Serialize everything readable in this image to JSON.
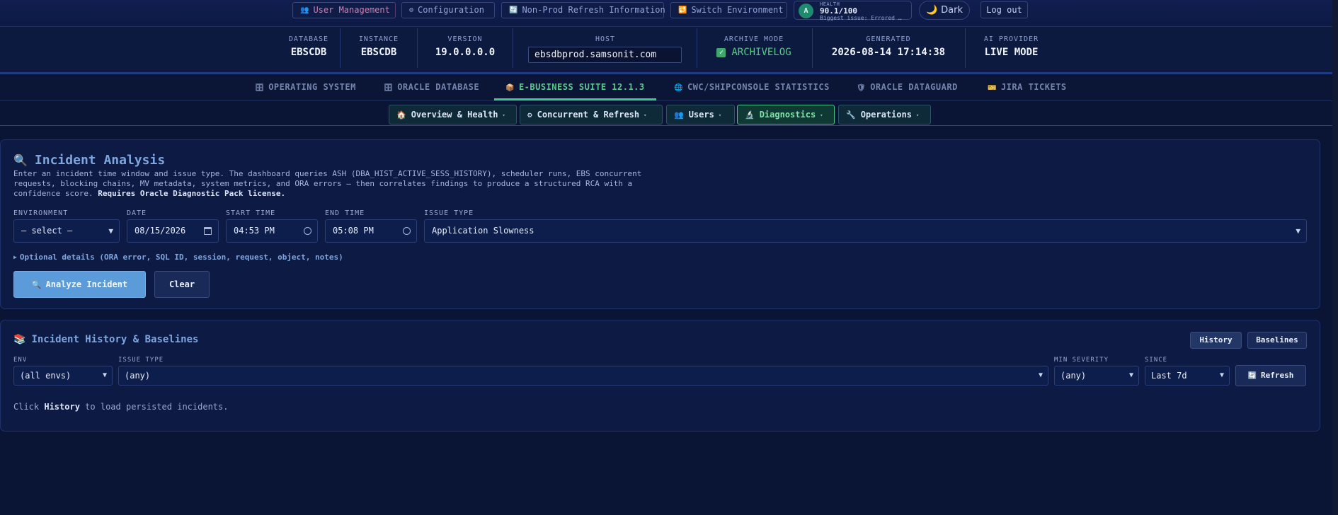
{
  "topnav": {
    "user_management": "User Management",
    "configuration": "Configuration",
    "nonprod_refresh": "Non-Prod Refresh Information",
    "switch_env": "Switch Environment",
    "health": {
      "grade": "A",
      "label": "HEALTH",
      "score": "90.1/100",
      "issue": "Biggest issue: Errored …"
    },
    "theme": "Dark",
    "logout": "Log out"
  },
  "info": {
    "database": {
      "label": "DATABASE",
      "value": "EBSCDB"
    },
    "instance": {
      "label": "INSTANCE",
      "value": "EBSCDB"
    },
    "version": {
      "label": "VERSION",
      "value": "19.0.0.0.0"
    },
    "host": {
      "label": "HOST",
      "value": "ebsdbprod.samsonit.com"
    },
    "archive": {
      "label": "ARCHIVE MODE",
      "value": "ARCHIVELOG"
    },
    "generated": {
      "label": "GENERATED",
      "value": "2026-08-14 17:14:38"
    },
    "ai_provider": {
      "label": "AI PROVIDER",
      "value": "LIVE MODE"
    }
  },
  "main_tabs": [
    {
      "label": "OPERATING SYSTEM",
      "icon": "server-icon",
      "active": false
    },
    {
      "label": "ORACLE DATABASE",
      "icon": "database-icon",
      "active": false
    },
    {
      "label": "E-BUSINESS SUITE 12.1.3",
      "icon": "package-icon",
      "active": true
    },
    {
      "label": "CWC/SHIPCONSOLE STATISTICS",
      "icon": "globe-icon",
      "active": false
    },
    {
      "label": "ORACLE DATAGUARD",
      "icon": "shield-icon",
      "active": false
    },
    {
      "label": "JIRA TICKETS",
      "icon": "ticket-icon",
      "active": false
    }
  ],
  "sub_tabs": [
    {
      "label": "Overview & Health",
      "icon": "house-icon"
    },
    {
      "label": "Concurrent & Refresh",
      "icon": "gear-icon"
    },
    {
      "label": "Users",
      "icon": "users-icon"
    },
    {
      "label": "Diagnostics",
      "icon": "microscope-icon",
      "active": true
    },
    {
      "label": "Operations",
      "icon": "wrench-icon"
    }
  ],
  "incident": {
    "title": "Incident Analysis",
    "description": "Enter an incident time window and issue type. The dashboard queries ASH (DBA_HIST_ACTIVE_SESS_HISTORY), scheduler runs, EBS concurrent requests, blocking chains, MV metadata, system metrics, and ORA errors — then correlates findings to produce a structured RCA with a confidence score.",
    "description_bold": "Requires Oracle Diagnostic Pack license.",
    "labels": {
      "environment": "ENVIRONMENT",
      "date": "DATE",
      "start_time": "START TIME",
      "end_time": "END TIME",
      "issue_type": "ISSUE TYPE"
    },
    "environment_value": "— select —",
    "date_value": "08/15/2026",
    "start_time_value": "04:53 PM",
    "end_time_value": "05:08 PM",
    "issue_type_value": "Application Slowness",
    "optional_details": "Optional details (ORA error, SQL ID, session, request, object, notes)",
    "analyze_label": "Analyze Incident",
    "clear_label": "Clear"
  },
  "history": {
    "title": "Incident History & Baselines",
    "history_btn": "History",
    "baselines_btn": "Baselines",
    "labels": {
      "env": "ENV",
      "issue_type": "ISSUE TYPE",
      "min_severity": "MIN SEVERITY",
      "since": "SINCE"
    },
    "env_value": "(all envs)",
    "issue_type_value": "(any)",
    "min_severity_value": "(any)",
    "since_value": "Last 7d",
    "refresh_label": "Refresh",
    "hint_pre": "Click",
    "hint_bold": "History",
    "hint_post": "to load persisted incidents."
  }
}
